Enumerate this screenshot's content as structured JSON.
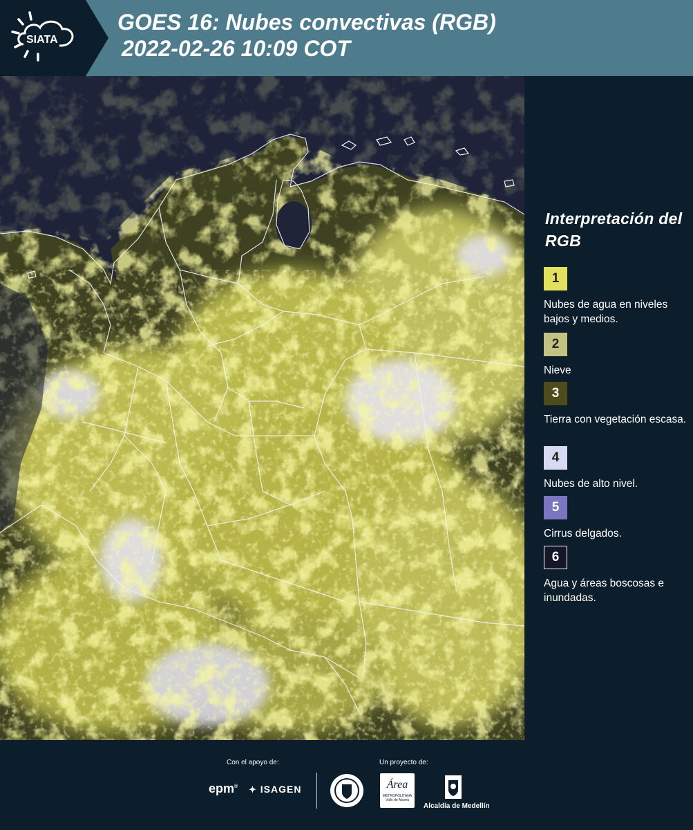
{
  "header": {
    "title_line1": "GOES 16: Nubes convectivas (RGB)",
    "title_line2": "2022-02-26 10:09 COT",
    "logo_text": "SIATA",
    "background_color": "#4f7c8d",
    "logo_color": "#0c1e2c"
  },
  "map": {
    "description_icon": "satellite-rgb-map",
    "boundary_color": "#ffffff",
    "ocean_color": "#1e2338",
    "cloud_color": "#e0e04a"
  },
  "legend": {
    "title": "Interpretación del RGB",
    "items": [
      {
        "number": "1",
        "label": "Nubes de agua en niveles bajos y medios.",
        "color": "#e3e05e",
        "text_color": "#222222"
      },
      {
        "number": "2",
        "label": "Nieve",
        "color": "#c4c282",
        "text_color": "#222222"
      },
      {
        "number": "3",
        "label": "Tierra con vegetación escasa.",
        "color": "#4e4c1c",
        "text_color": "#ffffff"
      },
      {
        "number": "4",
        "label": "Nubes de alto nivel.",
        "color": "#d8d9f2",
        "text_color": "#222222"
      },
      {
        "number": "5",
        "label": "Cirrus delgados.",
        "color": "#7a76bf",
        "text_color": "#ffffff"
      },
      {
        "number": "6",
        "label": "Agua y áreas boscosas e inundadas.",
        "color": "#161629",
        "text_color": "#ffffff"
      }
    ]
  },
  "footer": {
    "support_label": "Con el apoyo de:",
    "project_label": "Un proyecto de:",
    "epm_text": "epm",
    "isagen_text": "ISAGEN",
    "area_text": "Área",
    "area_subtext1": "METROPOLITANA",
    "area_subtext2": "Valle de Aburrá",
    "alcaldia_text": "Alcaldía de Medellín"
  }
}
